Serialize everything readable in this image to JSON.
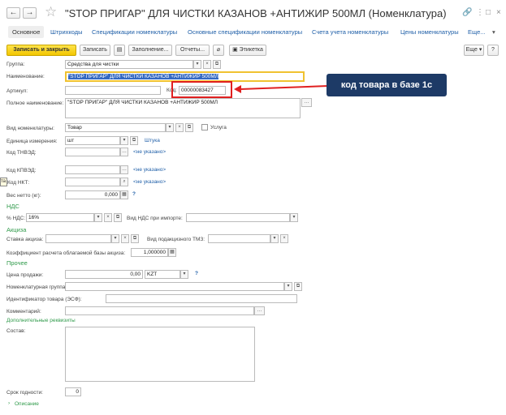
{
  "window": {
    "title": "\"STOP ПРИГАР\" ДЛЯ ЧИСТКИ КАЗАНОВ +АНТИЖИР 500МЛ (Номенклатура)",
    "back": "←",
    "forward": "→",
    "star": "☆",
    "link_icon": "🔗",
    "menu_icon": "⋮",
    "max_icon": "□",
    "close_icon": "×"
  },
  "tabs": [
    "Основное",
    "Штрихкоды",
    "Спецификации номенклатуры",
    "Основные спецификации номенклатуры",
    "Счета учета номенклатуры",
    "Цены номенклатуры",
    "Еще..."
  ],
  "toolbar": {
    "save_close": "Записать и закрыть",
    "save": "Записать",
    "fill": "Заполнение...",
    "reports": "Отчеты...",
    "label": "Этикетка",
    "more": "Еще",
    "help": "?"
  },
  "form": {
    "group_label": "Группа:",
    "group_value": "Средства для чистки",
    "name_label": "Наименование:",
    "name_value": "\"STOP ПРИГАР\" ДЛЯ ЧИСТКИ КАЗАНОВ +АНТИЖИР 500МЛ",
    "article_label": "Артикул:",
    "code_label": "Код:",
    "code_value": "00000083427",
    "fullname_label": "Полное наименование:",
    "fullname_value": "\"STOP ПРИГАР\" ДЛЯ ЧИСТКИ КАЗАНОВ +АНТИЖИР 500МЛ",
    "kind_label": "Вид номенклатуры:",
    "kind_value": "Товар",
    "service_label": "Услуга",
    "unit_label": "Единица измерения:",
    "unit_value": "шт",
    "unit_link": "Штука",
    "tnved_label": "Код ТНВЭД:",
    "not_specified": "<не указано>",
    "klved_label": "Код КПВЭД:",
    "nkt_label": "Код НКТ:",
    "weight_label": "Вес нетто (кг):",
    "weight_value": "0,000",
    "nds_section": "НДС",
    "nds_label": "% НДС:",
    "nds_value": "16%",
    "nds_import_label": "Вид НДС при импорте:",
    "excise_section": "Акциза",
    "excise_rate_label": "Ставка акциза:",
    "excise_kind_label": "Вид подакцизного ТМЗ:",
    "excise_coef_label": "Коэффициент расчета облагаемой базы акциза:",
    "excise_coef_value": "1,000000",
    "other_section": "Прочее",
    "price_label": "Цена продажи:",
    "price_value": "0,00",
    "currency_value": "KZT",
    "nom_group_label": "Номенклатурная группа:",
    "esf_label": "Идентификатор товара (ЭСФ):",
    "comment_label": "Комментарий:",
    "extra_section": "Дополнительные реквизиты",
    "composition_label": "Состав:",
    "shelf_label": "Срок годности:",
    "shelf_value": "0",
    "description_link": "Описание",
    "left_fragment": "та"
  },
  "annotation": {
    "text": "код товара в базе 1с",
    "color": "#e02020"
  }
}
